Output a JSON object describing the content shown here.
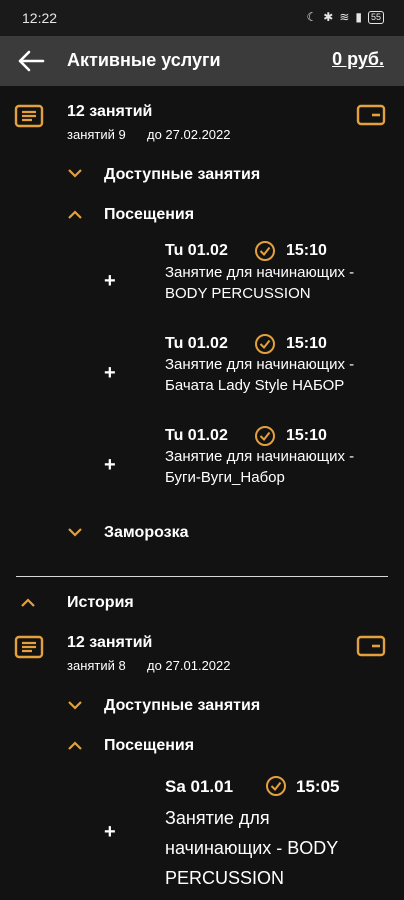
{
  "status_bar": {
    "time": "12:22",
    "battery": "55"
  },
  "app_bar": {
    "title": "Активные услуги",
    "balance": "0 руб."
  },
  "colors": {
    "accent": "#e3a03c",
    "background": "#121212",
    "appbar": "#3b3b3b"
  },
  "active": {
    "title": "12 занятий",
    "remaining": "занятий 9",
    "until": "до 27.02.2022",
    "available_label": "Доступные занятия",
    "visits_label": "Посещения",
    "visits": [
      {
        "date": "Tu 01.02",
        "time": "15:10",
        "name": "Занятие для начинающих - BODY PERCUSSION"
      },
      {
        "date": "Tu 01.02",
        "time": "15:10",
        "name": "Занятие для начинающих - Бачата Lady Style НАБОР"
      },
      {
        "date": "Tu 01.02",
        "time": "15:10",
        "name": "Занятие для начинающих - Буги-Вуги_Набор"
      }
    ],
    "freeze_label": "Заморозка"
  },
  "history": {
    "label": "История",
    "card": {
      "title": "12 занятий",
      "remaining": "занятий 8",
      "until": "до 27.01.2022",
      "available_label": "Доступные занятия",
      "visits_label": "Посещения",
      "visits": [
        {
          "date": "Sa 01.01",
          "time": "15:05",
          "name": "Занятие для начинающих - BODY PERCUSSION"
        }
      ]
    }
  }
}
